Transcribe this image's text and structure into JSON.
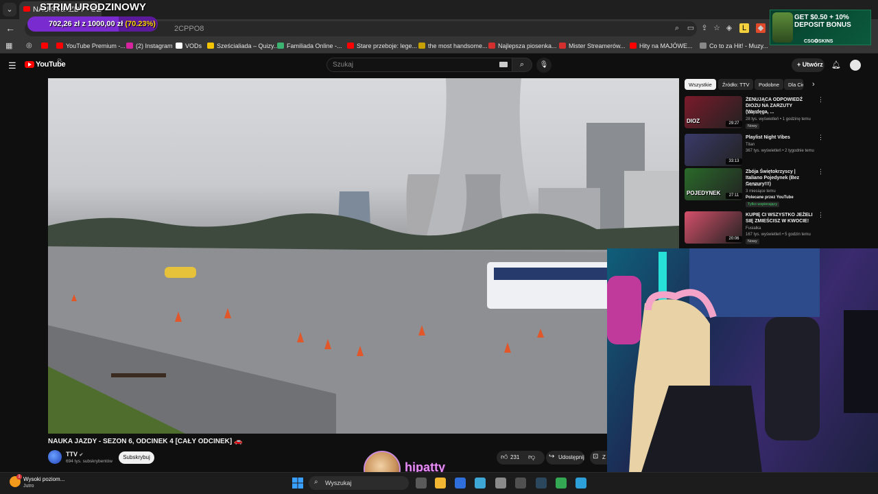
{
  "browser": {
    "active_tab_label": "NAUKA JAZDY - SEZON",
    "url_fragment": "2CPPO8",
    "bookmarks": [
      {
        "label": "",
        "color": "#ff0000"
      },
      {
        "label": "YouTube Premium -...",
        "color": "#ff0000"
      },
      {
        "label": "(2) Instagram",
        "color": "#d6249f"
      },
      {
        "label": "VODs",
        "color": "#ffffff"
      },
      {
        "label": "Sześcialiada – Quizy...",
        "color": "#f5c400"
      },
      {
        "label": "Familiada Online -...",
        "color": "#3cb371"
      },
      {
        "label": "Stare przeboje: lege...",
        "color": "#ff0000"
      },
      {
        "label": "the most handsome...",
        "color": "#c6a000"
      },
      {
        "label": "Najlepsza piosenka...",
        "color": "#d32f2f"
      },
      {
        "label": "Mister Streamerów...",
        "color": "#d32f2f"
      },
      {
        "label": "Hity na MAJÓWE...",
        "color": "#ff0000"
      },
      {
        "label": "Co to za Hit! - Muzy...",
        "color": "#888888"
      }
    ]
  },
  "youtube": {
    "logo_text": "YouTube",
    "logo_region": "PL",
    "search_placeholder": "Szukaj",
    "create_label": "Utwórz",
    "video": {
      "title": "NAUKA JAZDY - SEZON 6, ODCINEK 4 [CAŁY ODCINEK] 🚗",
      "channel": "TTV",
      "subscribers": "694 tys. subskrybentów",
      "subscribe_label": "Subskrybuj",
      "likes": "231",
      "share_label": "Udostępnij",
      "save_label": "Z"
    },
    "chips": [
      "Wszystkie",
      "Źródło: TTV",
      "Podobne",
      "Dla Ciebie"
    ],
    "recommended": [
      {
        "title": "ŻENUJĄCA ODPOWIEDŹ DIOZU NA ZARZUTY (Wardęga, ...",
        "channel": "Gimper",
        "meta": "28 tys. wyświetleń • 1 godzinę temu",
        "extra": "",
        "badge": "Nowy",
        "duration": "29:27",
        "thumb_color": "#7a1a2a",
        "thumb_text": "DIOZ"
      },
      {
        "title": "Playlist Night Vibes",
        "channel": "Titan",
        "meta": "367 tys. wyświetleń • 2 tygodnie temu",
        "extra": "",
        "badge": "",
        "duration": "33:13",
        "thumb_color": "#3a3a6a",
        "thumb_text": ""
      },
      {
        "title": "Zbója Świętokrzyscy | Italiano Pojedynek (Bez Cenzury!!!)",
        "channel": "Pronosz",
        "meta": "3 miesiące temu",
        "extra": "Polecane przez YouTube",
        "badge": "Tylko wspierający",
        "duration": "27:11",
        "thumb_color": "#2a6a2a",
        "thumb_text": "POJEDYNEK"
      },
      {
        "title": "KUPIĘ CI WSZYSTKO JEŻELI SIĘ ZMIEŚCISZ W KWOCIE!",
        "channel": "Fusialka",
        "meta": "167 tys. wyświetleń • 5 godzin temu",
        "extra": "",
        "badge": "Nowy",
        "duration": "20:06",
        "thumb_color": "#d4506a",
        "thumb_text": ""
      }
    ]
  },
  "stream": {
    "title": "STRIM URODZINOWY",
    "goal_current": "702,26 zł",
    "goal_separator": "z",
    "goal_target": "1000,00 zł",
    "goal_percent_label": "(70.23%)",
    "goal_fraction": 0.7023,
    "streamer_name": "hipatty",
    "ad_text": "GET $0.50 + 10% DEPOSIT BONUS",
    "ad_brand": "CSG✪SKINS"
  },
  "taskbar": {
    "weather_title": "Wysoki poziom...",
    "weather_subtitle": "Jutro",
    "weather_badge": "1",
    "search_placeholder": "Wyszukaj",
    "apps": [
      {
        "name": "task-view",
        "color": "#5a5a5a"
      },
      {
        "name": "file-explorer",
        "color": "#f2b632"
      },
      {
        "name": "microsoft-store",
        "color": "#2f6fdb"
      },
      {
        "name": "snipping-tool",
        "color": "#3fa7d6"
      },
      {
        "name": "settings",
        "color": "#8a8a8a"
      },
      {
        "name": "obs",
        "color": "#505050"
      },
      {
        "name": "steam",
        "color": "#2a475e"
      },
      {
        "name": "chrome",
        "color": "#34a853"
      },
      {
        "name": "app-window",
        "color": "#2d9fd9"
      }
    ]
  },
  "colors": {
    "youtube_red": "#ff0000",
    "background": "#0f0f0f",
    "goal_bar": "#7a2bd0",
    "streamer_name": "#e58ff2"
  }
}
